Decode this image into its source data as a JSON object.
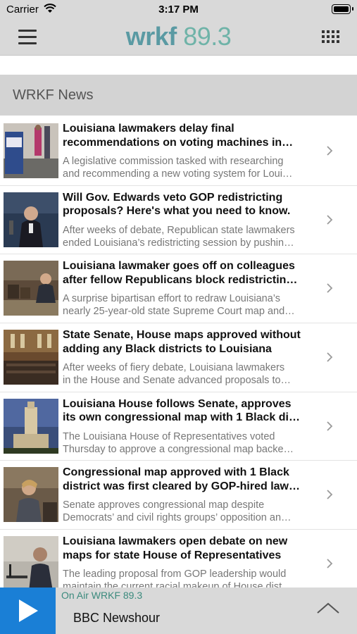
{
  "status_bar": {
    "carrier": "Carrier",
    "time": "3:17 PM"
  },
  "header": {
    "logo_text": "wrkf",
    "logo_number": "89.3"
  },
  "section": {
    "title": "WRKF News"
  },
  "news": [
    {
      "headline": [
        "Louisiana lawmakers delay final",
        "recommendations on voting machines in…"
      ],
      "summary": [
        "A legislative commission tasked with researching",
        "and recommending a new voting system for Loui…"
      ]
    },
    {
      "headline": [
        "Will Gov. Edwards veto GOP redistricting",
        "proposals? Here's what you need to know."
      ],
      "summary": [
        "After weeks of debate, Republican state lawmakers",
        "ended Louisiana’s redistricting session by pushin…"
      ]
    },
    {
      "headline": [
        "Louisiana lawmaker goes off on colleagues",
        "after fellow Republicans block redistrictin…"
      ],
      "summary": [
        "A surprise bipartisan effort to redraw Louisiana’s",
        "nearly 25-year-old state Supreme Court map and…"
      ]
    },
    {
      "headline": [
        "State Senate, House maps approved without",
        "adding any Black districts to Louisiana"
      ],
      "summary": [
        "After weeks of fiery debate, Louisiana lawmakers",
        "in the House and Senate advanced proposals to…"
      ]
    },
    {
      "headline": [
        "Louisiana House follows Senate, approves",
        "its own congressional map with 1 Black di…"
      ],
      "summary": [
        "The Louisiana House of Representatives voted",
        "Thursday to approve a congressional map backe…"
      ]
    },
    {
      "headline": [
        "Congressional map approved with 1 Black",
        "district was first cleared by GOP-hired law…"
      ],
      "summary": [
        "Senate approves congressional map despite",
        "Democrats’ and civil rights groups’ opposition an…"
      ]
    },
    {
      "headline": [
        "Louisiana lawmakers open debate on new",
        "maps for state House of Representatives"
      ],
      "summary": [
        "The leading proposal from GOP leadership would",
        "maintain the current racial makeup of House dist…"
      ]
    }
  ],
  "player": {
    "on_air": "On Air WRKF 89.3",
    "show": "BBC Newshour"
  },
  "colors": {
    "logo": "#5a9aa3",
    "play_button": "#1a7fd6",
    "on_air_text": "#3b8a7d",
    "header_bg": "#d9d9d9"
  },
  "icons": {
    "menu": "hamburger-icon",
    "grid": "grid-icon",
    "chevron": "chevron-right-icon",
    "play": "play-icon",
    "expand": "chevron-up-icon"
  }
}
